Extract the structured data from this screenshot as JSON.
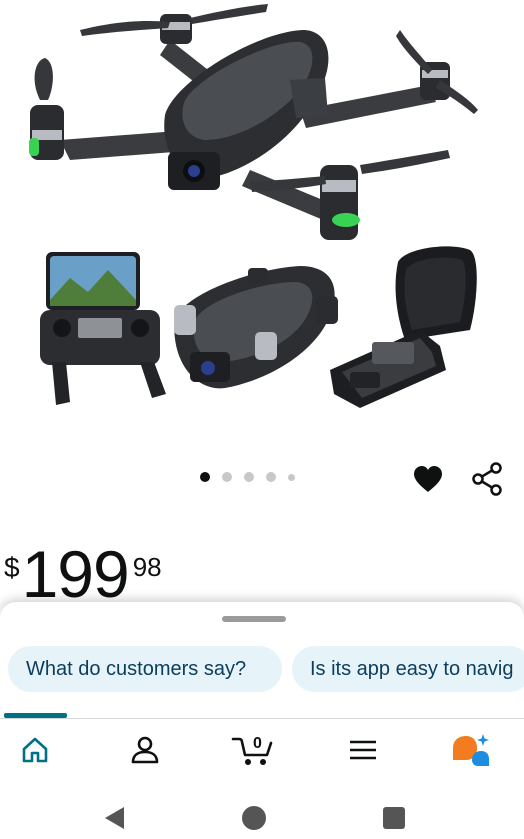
{
  "product": {
    "image_alt_icon": "drone-product-image",
    "carousel": {
      "total": 5,
      "active_index": 0
    }
  },
  "price": {
    "currency": "$",
    "whole": "199",
    "fraction": "98"
  },
  "rufus": {
    "suggestions": [
      "What do customers say?",
      "Is its app easy to navig"
    ]
  },
  "nav": {
    "cart_count": "0",
    "items": [
      "home-icon",
      "account-icon",
      "cart-icon",
      "menu-icon",
      "rufus-icon"
    ]
  },
  "colors": {
    "accent": "#007185",
    "chip_bg": "#e6f3f8",
    "chip_text": "#0b3d5c",
    "drone_light": "#39d353"
  }
}
